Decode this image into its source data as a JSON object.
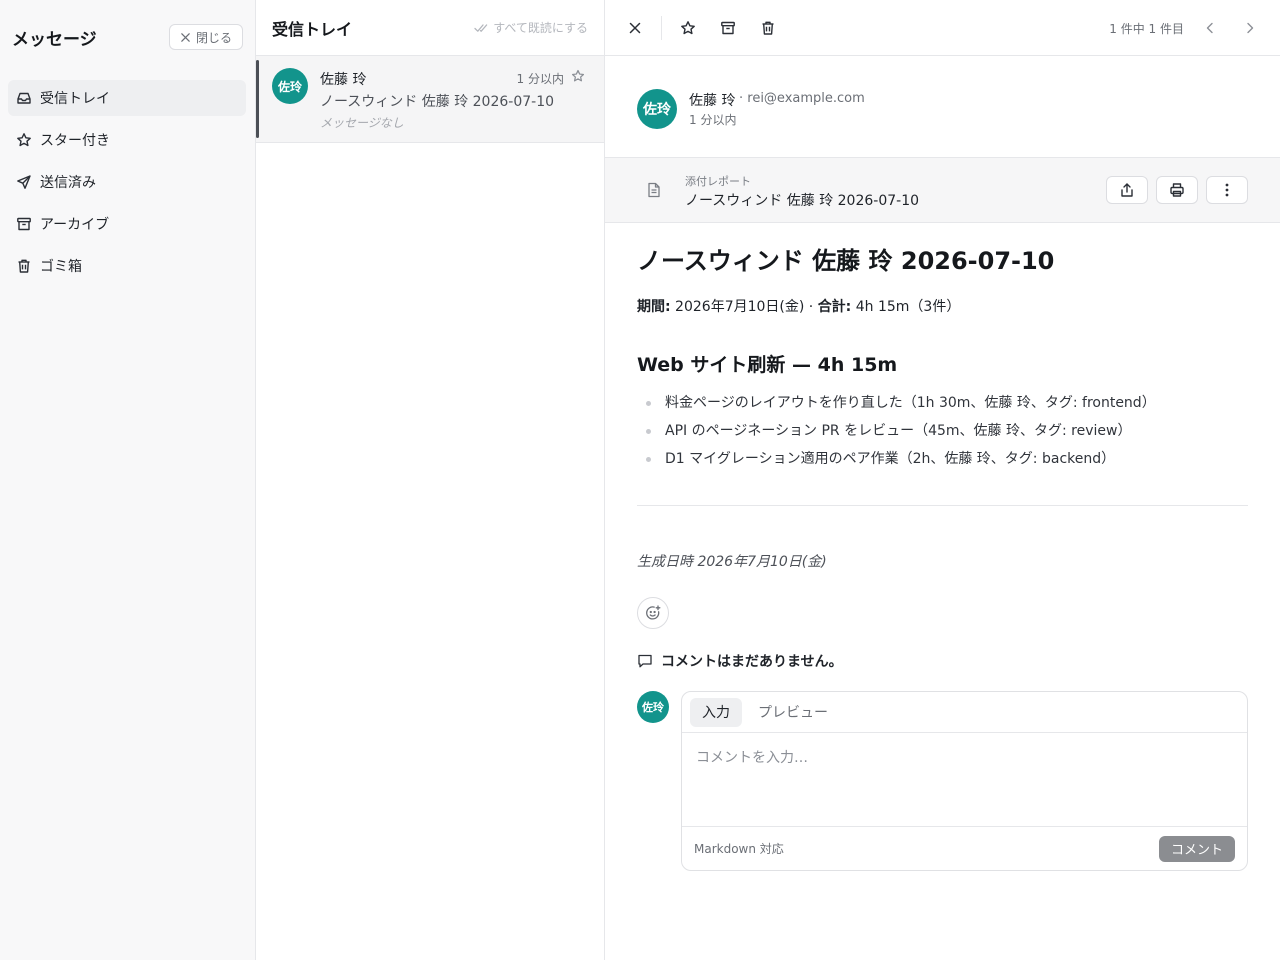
{
  "sidebar": {
    "title": "メッセージ",
    "close_label": "閉じる",
    "items": [
      {
        "label": "受信トレイ",
        "icon": "inbox-icon",
        "active": true
      },
      {
        "label": "スター付き",
        "icon": "star-icon"
      },
      {
        "label": "送信済み",
        "icon": "send-icon"
      },
      {
        "label": "アーカイブ",
        "icon": "archive-icon"
      },
      {
        "label": "ゴミ箱",
        "icon": "trash-icon"
      }
    ]
  },
  "inbox": {
    "title": "受信トレイ",
    "mark_all_read": "すべて既読にする",
    "messages": [
      {
        "avatar": "佐玲",
        "sender": "佐藤 玲",
        "time": "1 分以内",
        "subject": "ノースウィンド 佐藤 玲 2026-07-10",
        "preview": "メッセージなし"
      }
    ]
  },
  "detail": {
    "toolbar": {
      "count": "1 件中 1 件目"
    },
    "sender": {
      "avatar": "佐玲",
      "name": "佐藤 玲",
      "email": "· rei@example.com",
      "time": "1 分以内"
    },
    "attachment": {
      "label": "添付レポート",
      "title": "ノースウィンド 佐藤 玲 2026-07-10"
    },
    "doc": {
      "title": "ノースウィンド 佐藤 玲 2026-07-10",
      "period_label": "期間:",
      "period_value": " 2026年7月10日(金) · ",
      "total_label": "合計:",
      "total_value": " 4h 15m（3件）",
      "section_title": "Web サイト刷新 — 4h 15m",
      "entries": [
        "料金ページのレイアウトを作り直した（1h 30m、佐藤 玲、タグ: frontend）",
        "API のページネーション PR をレビュー（45m、佐藤 玲、タグ: review）",
        "D1 マイグレーション適用のペア作業（2h、佐藤 玲、タグ: backend）"
      ],
      "generated": "生成日時 2026年7月10日(金)"
    },
    "comments": {
      "empty_text": "コメントはまだありません。",
      "avatar": "佐玲",
      "tab_write": "入力",
      "tab_preview": "プレビュー",
      "placeholder": "コメントを入力…",
      "markdown_note": "Markdown 対応",
      "submit_label": "コメント"
    }
  },
  "colors": {
    "accent_avatar": "#12948c",
    "submit_disabled": "#8b8d91"
  }
}
